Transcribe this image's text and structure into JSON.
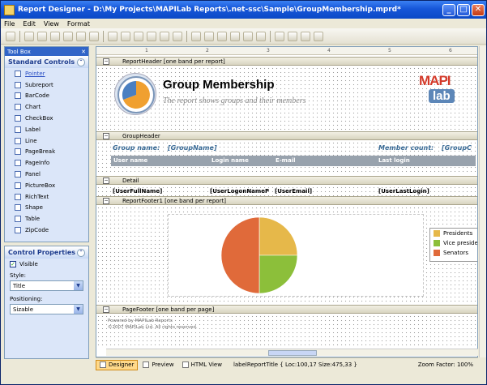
{
  "window": {
    "title": "Report Designer - D:\\My Projects\\MAPILab Reports\\.net-ssc\\Sample\\GroupMembership.mprd*"
  },
  "menu": [
    "File",
    "Edit",
    "View",
    "Format"
  ],
  "toolbox": {
    "pane_title": "Tool Box",
    "section": "Standard Controls",
    "items": [
      "Pointer",
      "Subreport",
      "BarCode",
      "Chart",
      "CheckBox",
      "Label",
      "Line",
      "PageBreak",
      "PageInfo",
      "Panel",
      "PictureBox",
      "RichText",
      "Shape",
      "Table",
      "ZipCode"
    ]
  },
  "control_properties": {
    "section": "Control Properties",
    "visible_label": "Visible",
    "style_label": "Style:",
    "style_value": "Title",
    "positioning_label": "Positioning:",
    "positioning_value": "Sizable"
  },
  "ruler": [
    "1",
    "2",
    "3",
    "4",
    "5",
    "6"
  ],
  "bands": {
    "report_header": "ReportHeader [one band per report]",
    "group_header": "GroupHeader",
    "detail": "Detail",
    "report_footer": "ReportFooter1 [one band per report]",
    "page_footer": "PageFooter [one band per page]"
  },
  "report_header": {
    "title": "Group Membership",
    "subtitle": "The report shows groups and their members",
    "logo_top": "MAPI",
    "logo_bottom": "lab"
  },
  "group_header": {
    "group_name_label": "Group name:",
    "group_name_field": "[GroupName]",
    "member_count_label": "Member count:",
    "group_count_field": "[GroupC",
    "columns": [
      "User name",
      "Login name",
      "E-mail",
      "Last login"
    ]
  },
  "detail": {
    "fields": [
      "[UserFullName]",
      "[UserLogonNameP",
      "[UserEmail]",
      "[UserLastLogin]"
    ]
  },
  "chart_data": {
    "type": "pie",
    "categories": [
      "Presidents",
      "Vice presidents",
      "Senators"
    ],
    "values": [
      25,
      25,
      50
    ],
    "colors": [
      "#e6b84a",
      "#8cbf3a",
      "#e06a3a"
    ],
    "legend": "right"
  },
  "page_footer": {
    "line1": "Powered by MAPILab Reports",
    "line2": "©2007 MAPILab Ltd. All rights reserved."
  },
  "status_tabs": [
    "Designer",
    "Preview",
    "HTML View"
  ],
  "status_info": "labelReportTitle { Loc:100,17 Size:475,33 }",
  "zoom": "Zoom Factor: 100%"
}
